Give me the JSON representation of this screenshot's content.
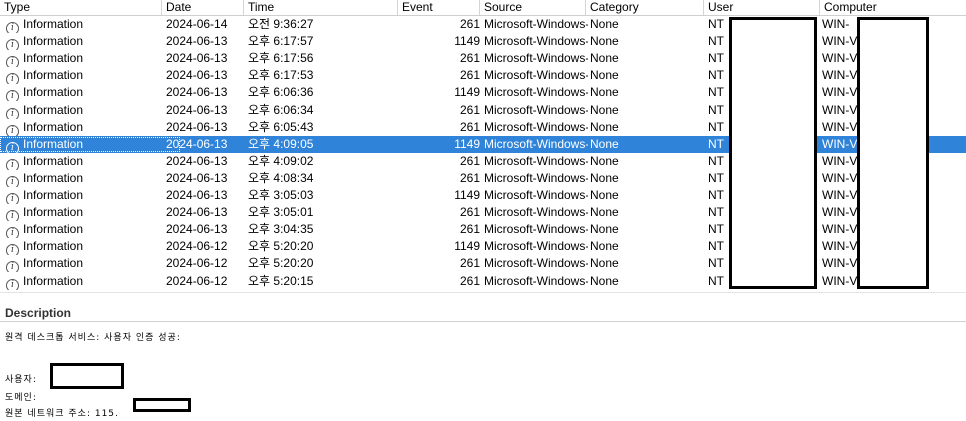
{
  "columns": {
    "type": "Type",
    "date": "Date",
    "time": "Time",
    "event": "Event",
    "source": "Source",
    "category": "Category",
    "user": "User",
    "computer": "Computer"
  },
  "rows": [
    {
      "type": "Information",
      "date": "2024-06-14",
      "time": "오전 9:36:27",
      "event": "261",
      "source": "Microsoft-Windows-",
      "category": "None",
      "user": "NT",
      "computer": "WIN-",
      "selected": false
    },
    {
      "type": "Information",
      "date": "2024-06-13",
      "time": "오후 6:17:57",
      "event": "1149",
      "source": "Microsoft-Windows-",
      "category": "None",
      "user": "NT",
      "computer": "WIN-V",
      "selected": false
    },
    {
      "type": "Information",
      "date": "2024-06-13",
      "time": "오후 6:17:56",
      "event": "261",
      "source": "Microsoft-Windows-",
      "category": "None",
      "user": "NT",
      "computer": "WIN-V",
      "selected": false
    },
    {
      "type": "Information",
      "date": "2024-06-13",
      "time": "오후 6:17:53",
      "event": "261",
      "source": "Microsoft-Windows-",
      "category": "None",
      "user": "NT",
      "computer": "WIN-V",
      "selected": false
    },
    {
      "type": "Information",
      "date": "2024-06-13",
      "time": "오후 6:06:36",
      "event": "1149",
      "source": "Microsoft-Windows-",
      "category": "None",
      "user": "NT",
      "computer": "WIN-V",
      "selected": false
    },
    {
      "type": "Information",
      "date": "2024-06-13",
      "time": "오후 6:06:34",
      "event": "261",
      "source": "Microsoft-Windows-",
      "category": "None",
      "user": "NT",
      "computer": "WIN-V",
      "selected": false
    },
    {
      "type": "Information",
      "date": "2024-06-13",
      "time": "오후 6:05:43",
      "event": "261",
      "source": "Microsoft-Windows-",
      "category": "None",
      "user": "NT",
      "computer": "WIN-V",
      "selected": false
    },
    {
      "type": "Information",
      "date": "2024-06-13",
      "time": "오후 4:09:05",
      "event": "1149",
      "source": "Microsoft-Windows-",
      "category": "None",
      "user": "NT",
      "computer": "WIN-V",
      "selected": true
    },
    {
      "type": "Information",
      "date": "2024-06-13",
      "time": "오후 4:09:02",
      "event": "261",
      "source": "Microsoft-Windows-",
      "category": "None",
      "user": "NT",
      "computer": "WIN-V",
      "selected": false
    },
    {
      "type": "Information",
      "date": "2024-06-13",
      "time": "오후 4:08:34",
      "event": "261",
      "source": "Microsoft-Windows-",
      "category": "None",
      "user": "NT",
      "computer": "WIN-V",
      "selected": false
    },
    {
      "type": "Information",
      "date": "2024-06-13",
      "time": "오후 3:05:03",
      "event": "1149",
      "source": "Microsoft-Windows-",
      "category": "None",
      "user": "NT",
      "computer": "WIN-V",
      "selected": false
    },
    {
      "type": "Information",
      "date": "2024-06-13",
      "time": "오후 3:05:01",
      "event": "261",
      "source": "Microsoft-Windows-",
      "category": "None",
      "user": "NT",
      "computer": "WIN-V",
      "selected": false
    },
    {
      "type": "Information",
      "date": "2024-06-13",
      "time": "오후 3:04:35",
      "event": "261",
      "source": "Microsoft-Windows-",
      "category": "None",
      "user": "NT",
      "computer": "WIN-V",
      "selected": false
    },
    {
      "type": "Information",
      "date": "2024-06-12",
      "time": "오후 5:20:20",
      "event": "1149",
      "source": "Microsoft-Windows-",
      "category": "None",
      "user": "NT",
      "computer": "WIN-V",
      "selected": false
    },
    {
      "type": "Information",
      "date": "2024-06-12",
      "time": "오후 5:20:20",
      "event": "261",
      "source": "Microsoft-Windows-",
      "category": "None",
      "user": "NT",
      "computer": "WIN-V",
      "selected": false
    },
    {
      "type": "Information",
      "date": "2024-06-12",
      "time": "오후 5:20:15",
      "event": "261",
      "source": "Microsoft-Windows-",
      "category": "None",
      "user": "NT",
      "computer": "WIN-V",
      "selected": false
    }
  ],
  "description": {
    "title": "Description",
    "line1": "원격 데스크톱 서비스: 사용자 인증 성공:",
    "user_label": "사용자:",
    "domain_label": "도메인:",
    "ip_label": "원본 네트워크 주소: 115."
  },
  "icons": {
    "type_icon": "info-circle-icon"
  },
  "colors": {
    "selection": "#2f83d8",
    "redaction_border": "#000000"
  }
}
